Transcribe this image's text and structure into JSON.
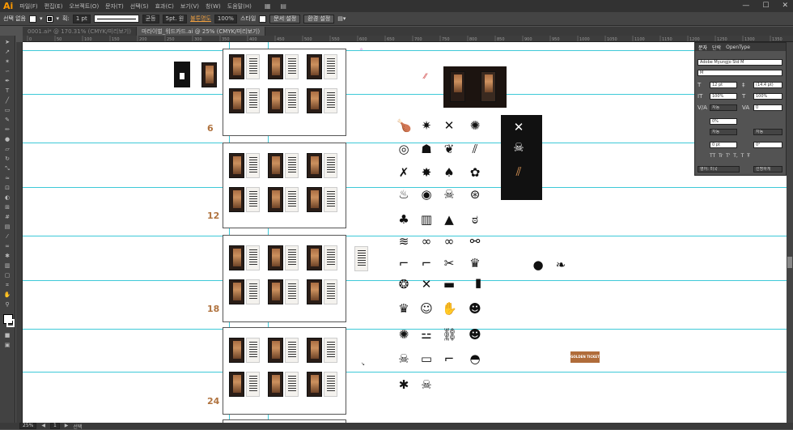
{
  "menubar": {
    "logo": "Ai",
    "items": [
      "파일(F)",
      "편집(E)",
      "오브젝트(O)",
      "문자(T)",
      "선택(S)",
      "효과(C)",
      "보기(V)",
      "창(W)",
      "도움말(H)"
    ],
    "window_controls": [
      "—",
      "☐",
      "✕"
    ]
  },
  "control": {
    "selection_label": "선택 없음",
    "stroke_weight": "1 pt",
    "uniform": "균등",
    "brush": "5pt. 원",
    "opacity_link": "불투명도",
    "opacity": "100%",
    "style_label": "스타일",
    "doc_setup": "문서 설정",
    "prefs": "환경 설정"
  },
  "tabs": [
    {
      "label": "0001.ai* @ 170.31% (CMYK/미리보기)"
    },
    {
      "label": "마라이벌_워드카드.ai @ 25% (CMYK/미리보기)"
    }
  ],
  "ruler": {
    "ticks": [
      "0",
      "50",
      "100",
      "150",
      "200",
      "250",
      "300",
      "350",
      "400",
      "450",
      "500",
      "550",
      "600",
      "650",
      "700",
      "750",
      "800",
      "850",
      "900",
      "950",
      "1000",
      "1050",
      "1100",
      "1150",
      "1200",
      "1250",
      "1300",
      "1350"
    ]
  },
  "artboard_labels": [
    "6",
    "12",
    "18",
    "24"
  ],
  "badge_text": "GOLDEN TICKET",
  "panel": {
    "tabs": [
      "문자",
      "단락",
      "OpenType"
    ],
    "font": "Adobe Myungjo Std M",
    "style": "M",
    "size": "12 pt",
    "leading": "(14.4 pt)",
    "hscale": "100%",
    "vscale": "100%",
    "tracking": "0",
    "kerning": "자동",
    "baseline": "0 pt",
    "rotation": "0°",
    "shift": "0%",
    "lang": "영어: 미국",
    "aa": "선명하게"
  },
  "status": {
    "zoom": "25%",
    "page": "1",
    "tool": "선택"
  }
}
